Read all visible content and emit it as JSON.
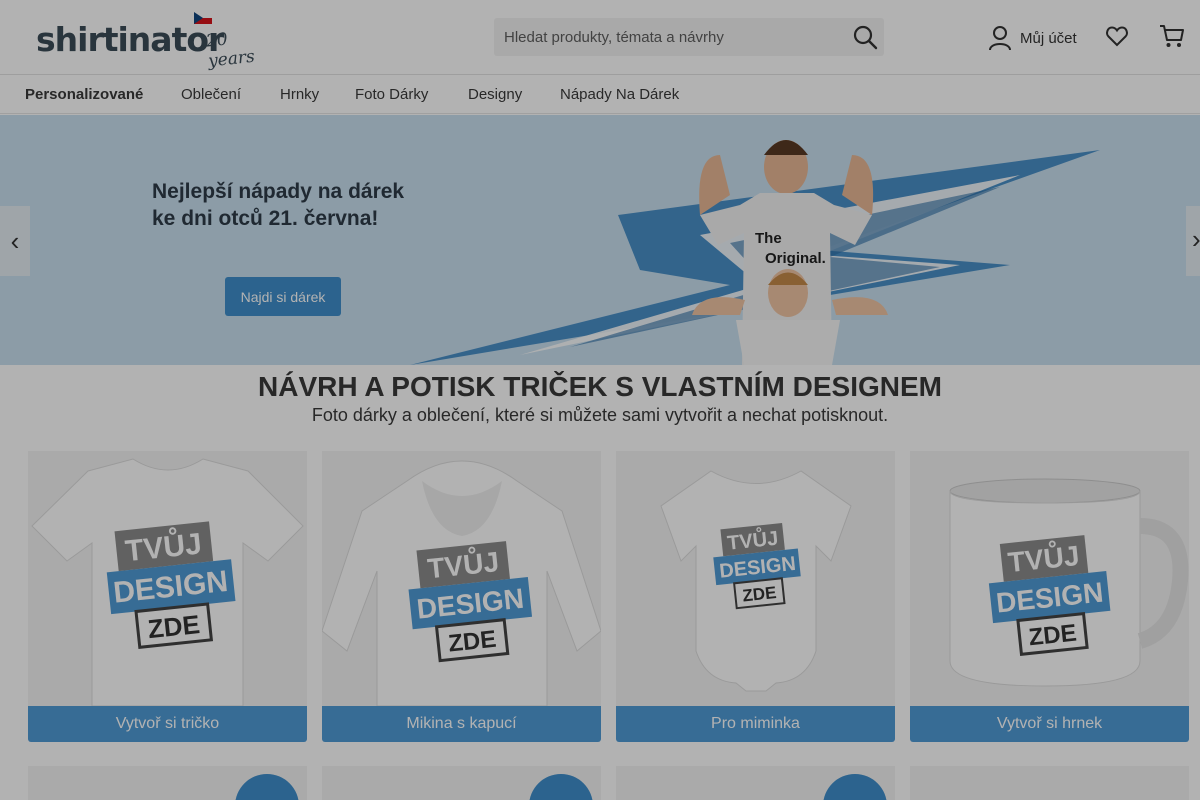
{
  "brand": {
    "name": "shirtinator",
    "tagline": "20 years"
  },
  "search": {
    "placeholder": "Hledat produkty, témata a návrhy"
  },
  "header": {
    "account_label": "Můj účet"
  },
  "nav": {
    "items": [
      "Personalizované",
      "Oblečení",
      "Hrnky",
      "Foto Dárky",
      "Designy",
      "Nápady Na Dárek"
    ]
  },
  "hero": {
    "title_line1": "Nejlepší nápady na dárek",
    "title_line2": "ke dni otců 21. června!",
    "button": "Najdi si dárek",
    "shirt_text_line1": "The",
    "shirt_text_line2": "Original."
  },
  "section": {
    "title": "NÁVRH A POTISK TRIČEK S VLASTNÍM DESIGNEM",
    "subtitle": "Foto dárky a oblečení, které si můžete sami vytvořit a nechat potisknout."
  },
  "products": [
    {
      "label": "Vytvoř si tričko"
    },
    {
      "label": "Mikina s kapucí"
    },
    {
      "label": "Pro miminka"
    },
    {
      "label": "Vytvoř si hrnek"
    }
  ],
  "design_badge": {
    "line1": "TVŮJ",
    "line2": "DESIGN",
    "line3": "ZDE"
  },
  "colors": {
    "accent": "#4f9bd6",
    "hero_bg": "#c9e0f0",
    "text": "#3a3a3a"
  }
}
